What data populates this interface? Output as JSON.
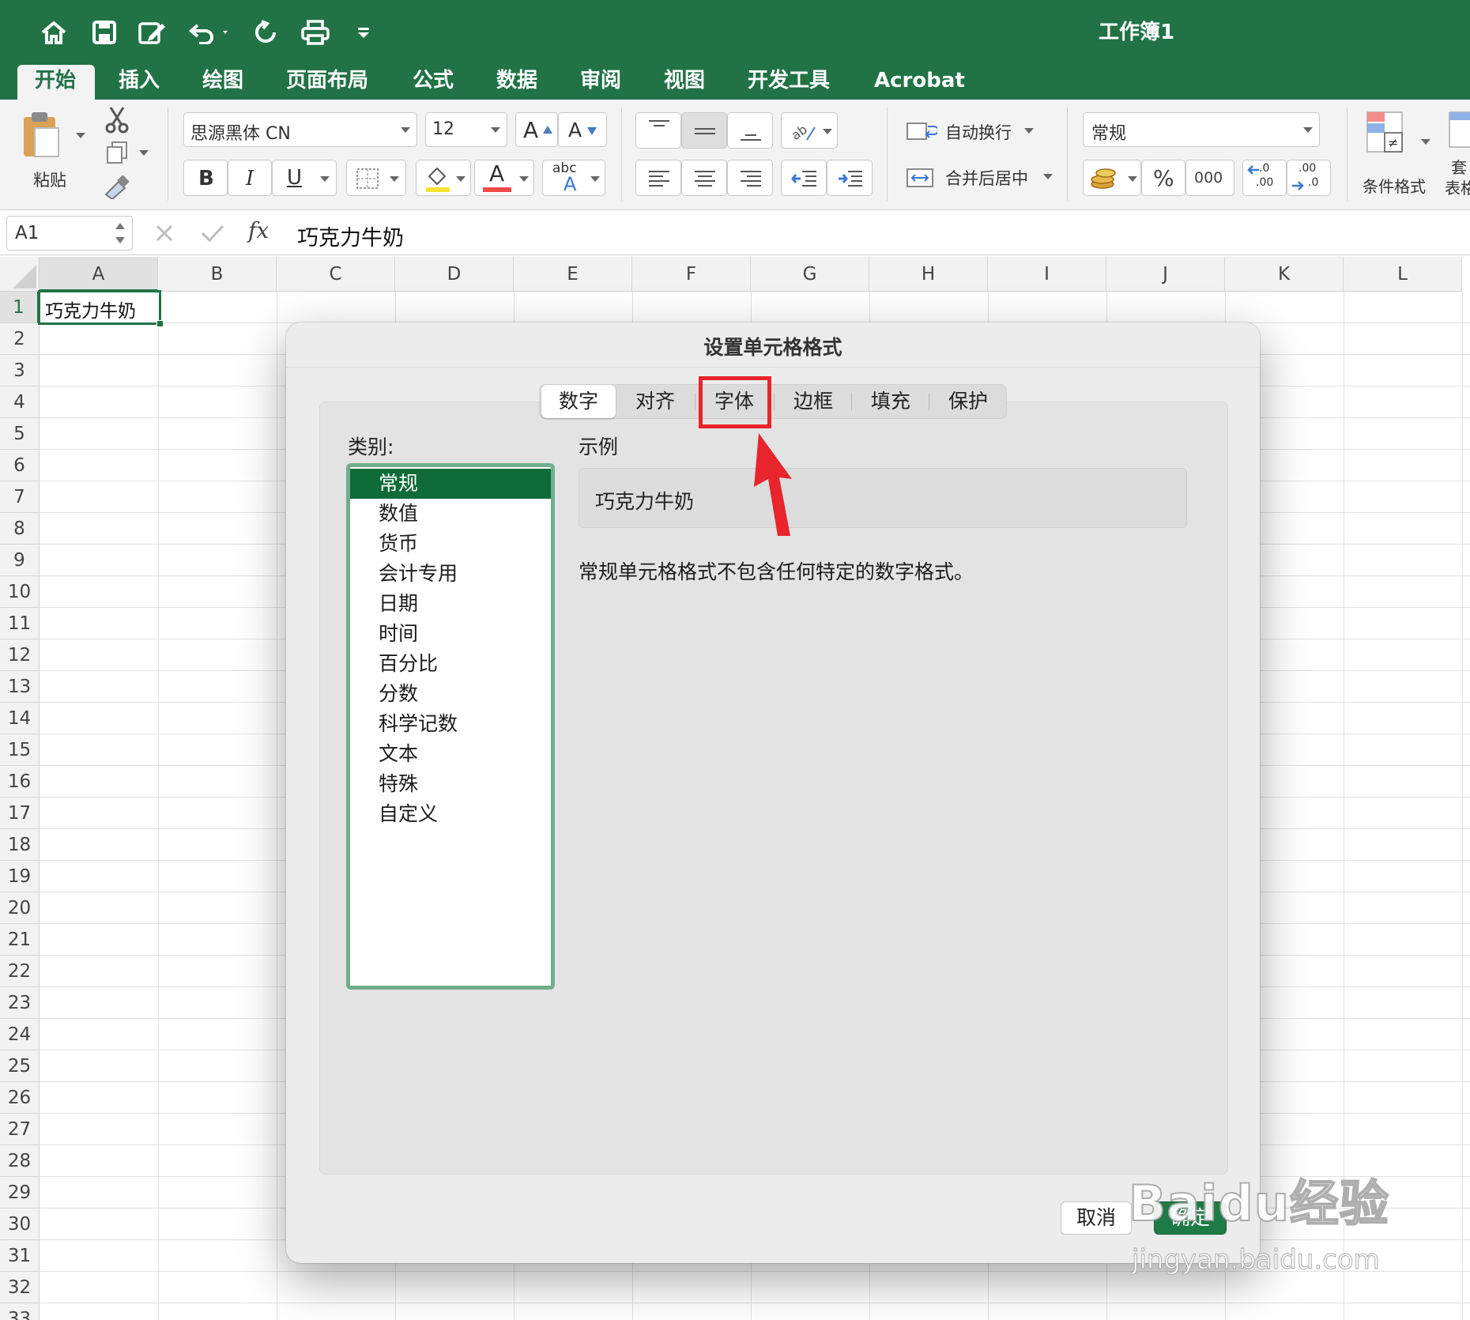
{
  "window": {
    "title": "工作簿1"
  },
  "quick_access": [
    "home-icon",
    "save-icon",
    "edit-icon",
    "undo-icon",
    "redo-icon",
    "print-icon",
    "customize-icon"
  ],
  "tabs": [
    {
      "label": "开始",
      "active": true
    },
    {
      "label": "插入"
    },
    {
      "label": "绘图"
    },
    {
      "label": "页面布局"
    },
    {
      "label": "公式"
    },
    {
      "label": "数据"
    },
    {
      "label": "审阅"
    },
    {
      "label": "视图"
    },
    {
      "label": "开发工具"
    },
    {
      "label": "Acrobat"
    }
  ],
  "ribbon": {
    "paste_label": "粘贴",
    "font_name": "思源黑体 CN",
    "font_size": "12",
    "bold": "B",
    "italic": "I",
    "underline": "U",
    "font_color_letter": "A",
    "phonetic_small": "abc",
    "phonetic_big": "A",
    "grow_font": "A",
    "shrink_font": "A",
    "wrap_text": "自动换行",
    "merge_center": "合并后居中",
    "number_format": "常规",
    "percent": "%",
    "thousands": "000",
    "inc_decimal": ".0",
    "inc_decimal_2": ".00",
    "dec_decimal": ".00",
    "dec_decimal_2": ".0",
    "conditional_format": "条件格式",
    "table_format": "套用表格",
    "table_format_1": "套",
    "table_format_2": "表格"
  },
  "formula_bar": {
    "cell_ref": "A1",
    "fx": "fx",
    "content": "巧克力牛奶"
  },
  "sheet": {
    "columns": [
      "A",
      "B",
      "C",
      "D",
      "E",
      "F",
      "G",
      "H",
      "I",
      "J",
      "K",
      "L"
    ],
    "rows": [
      "1",
      "2",
      "3",
      "4",
      "5",
      "6",
      "7",
      "8",
      "9",
      "10",
      "11",
      "12",
      "13",
      "14",
      "15",
      "16",
      "17",
      "18",
      "19",
      "20",
      "21",
      "22",
      "23",
      "24",
      "25",
      "26",
      "27",
      "28",
      "29",
      "30",
      "31",
      "32",
      "33"
    ],
    "a1": "巧克力牛奶"
  },
  "dialog": {
    "title": "设置单元格格式",
    "tabs": [
      "数字",
      "对齐",
      "字体",
      "边框",
      "填充",
      "保护"
    ],
    "selected_tab": "数字",
    "highlighted_tab": "字体",
    "category_label": "类别:",
    "categories": [
      "常规",
      "数值",
      "货币",
      "会计专用",
      "日期",
      "时间",
      "百分比",
      "分数",
      "科学记数",
      "文本",
      "特殊",
      "自定义"
    ],
    "selected_category": "常规",
    "sample_label": "示例",
    "sample_value": "巧克力牛奶",
    "description": "常规单元格格式不包含任何特定的数字格式。",
    "cancel": "取消",
    "ok": "确定"
  },
  "watermark": {
    "main": "Baidu经验",
    "sub": "jingyan.baidu.com"
  },
  "colors": {
    "excel_green": "#217346",
    "selection_green": "#0f6b37",
    "annotation_red": "#e8242c"
  }
}
